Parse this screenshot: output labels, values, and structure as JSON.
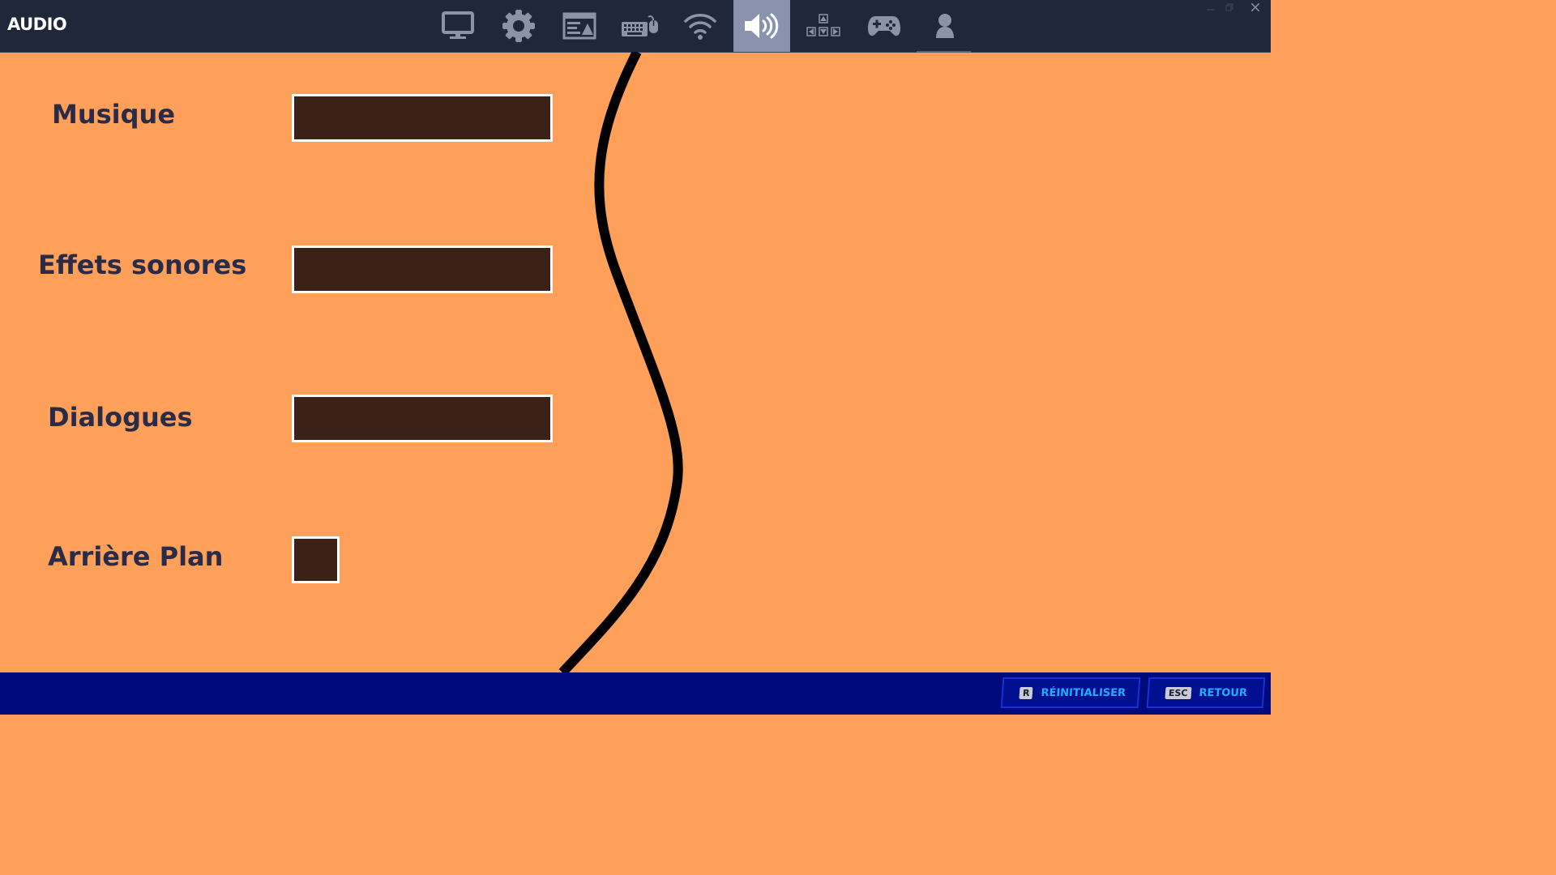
{
  "window": {
    "title": "AUDIO"
  },
  "tabs": [
    {
      "name": "display-tab",
      "icon": "monitor-icon",
      "active": false
    },
    {
      "name": "game-settings-tab",
      "icon": "gear-icon",
      "active": false
    },
    {
      "name": "brightness-tab",
      "icon": "window-image-icon",
      "active": false
    },
    {
      "name": "keyboard-mouse-tab",
      "icon": "keyboard-mouse-icon",
      "active": false
    },
    {
      "name": "network-tab",
      "icon": "wifi-icon",
      "active": false
    },
    {
      "name": "audio-tab",
      "icon": "speaker-icon",
      "active": true
    },
    {
      "name": "touch-controls-tab",
      "icon": "dpad-icon",
      "active": false
    },
    {
      "name": "controller-tab",
      "icon": "gamepad-icon",
      "active": false
    },
    {
      "name": "account-tab",
      "icon": "user-icon",
      "active": false
    }
  ],
  "settings": {
    "music": {
      "label": "Musique",
      "value": 1.0
    },
    "sfx": {
      "label": "Effets sonores",
      "value": 1.0
    },
    "dialogue": {
      "label": "Dialogues",
      "value": 1.0
    },
    "background": {
      "label": "Arrière Plan",
      "checked": true
    }
  },
  "footer": {
    "reset": {
      "key": "R",
      "label": "RÉINITIALISER"
    },
    "back": {
      "key": "ESC",
      "label": "RETOUR"
    }
  },
  "colors": {
    "content_bg": "#ffa05a",
    "topbar_bg": "#20273b",
    "active_tab_bg": "#8a93ad",
    "slider_fill": "#3b2117",
    "label_text": "#2a2c47",
    "footer_bg": "#000a7a",
    "footer_text": "#1ab0ff"
  }
}
